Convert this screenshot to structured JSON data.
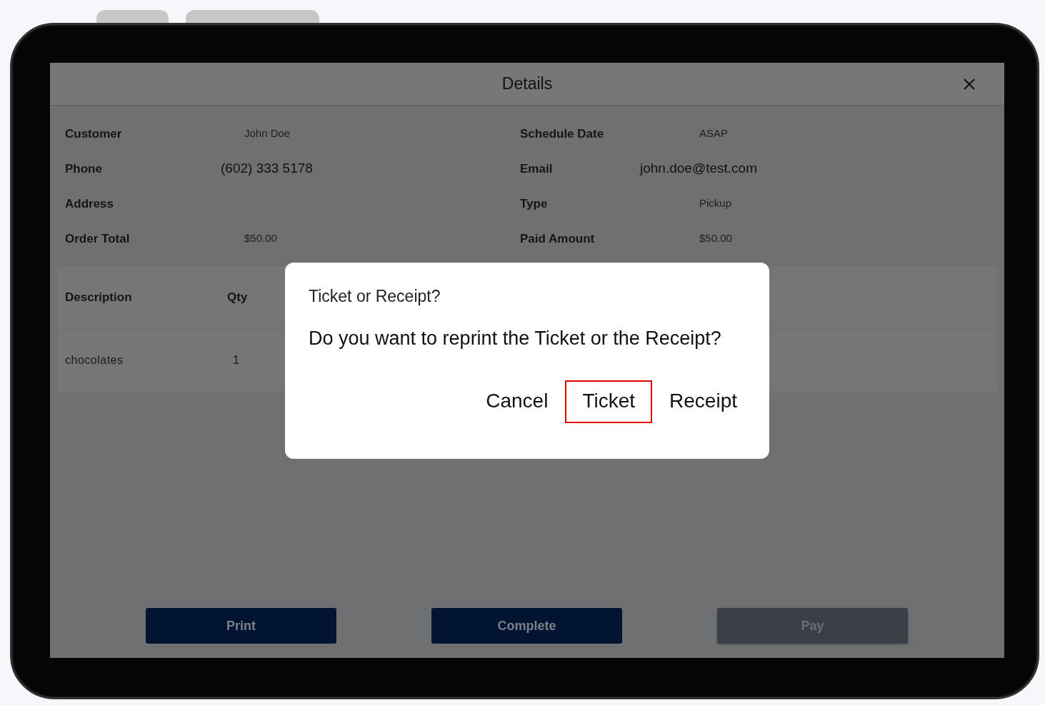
{
  "window": {
    "title": "Details"
  },
  "fields": [
    {
      "label": "Customer",
      "value": "John Doe",
      "kind": "plain"
    },
    {
      "label": "Schedule Date",
      "value": "ASAP",
      "kind": "plain"
    },
    {
      "label": "Phone",
      "value": "(602) 333 5178",
      "kind": "large"
    },
    {
      "label": "Email",
      "value": "john.doe@test.com",
      "kind": "large"
    },
    {
      "label": "Address",
      "kind": "plain"
    },
    {
      "label": "Type",
      "value": "Pickup",
      "kind": "plain"
    },
    {
      "label": "Order Total",
      "value": "$50.00",
      "kind": "plain"
    },
    {
      "label": "Paid Amount",
      "value": "$50.00",
      "kind": "plain"
    }
  ],
  "table": {
    "columns": [
      "Description",
      "Qty"
    ],
    "rows": [
      [
        "chocolates",
        "1"
      ]
    ]
  },
  "actions": [
    {
      "label": "Print",
      "disabled": false
    },
    {
      "label": "Complete",
      "disabled": false
    },
    {
      "label": "Pay",
      "disabled": true
    }
  ],
  "dialog": {
    "title": "Ticket or Receipt?",
    "message": "Do you want to reprint the Ticket or the Receipt?",
    "buttons": [
      {
        "label": "Cancel",
        "highlighted": false
      },
      {
        "label": "Ticket",
        "highlighted": true
      },
      {
        "label": "Receipt",
        "highlighted": false
      }
    ]
  }
}
